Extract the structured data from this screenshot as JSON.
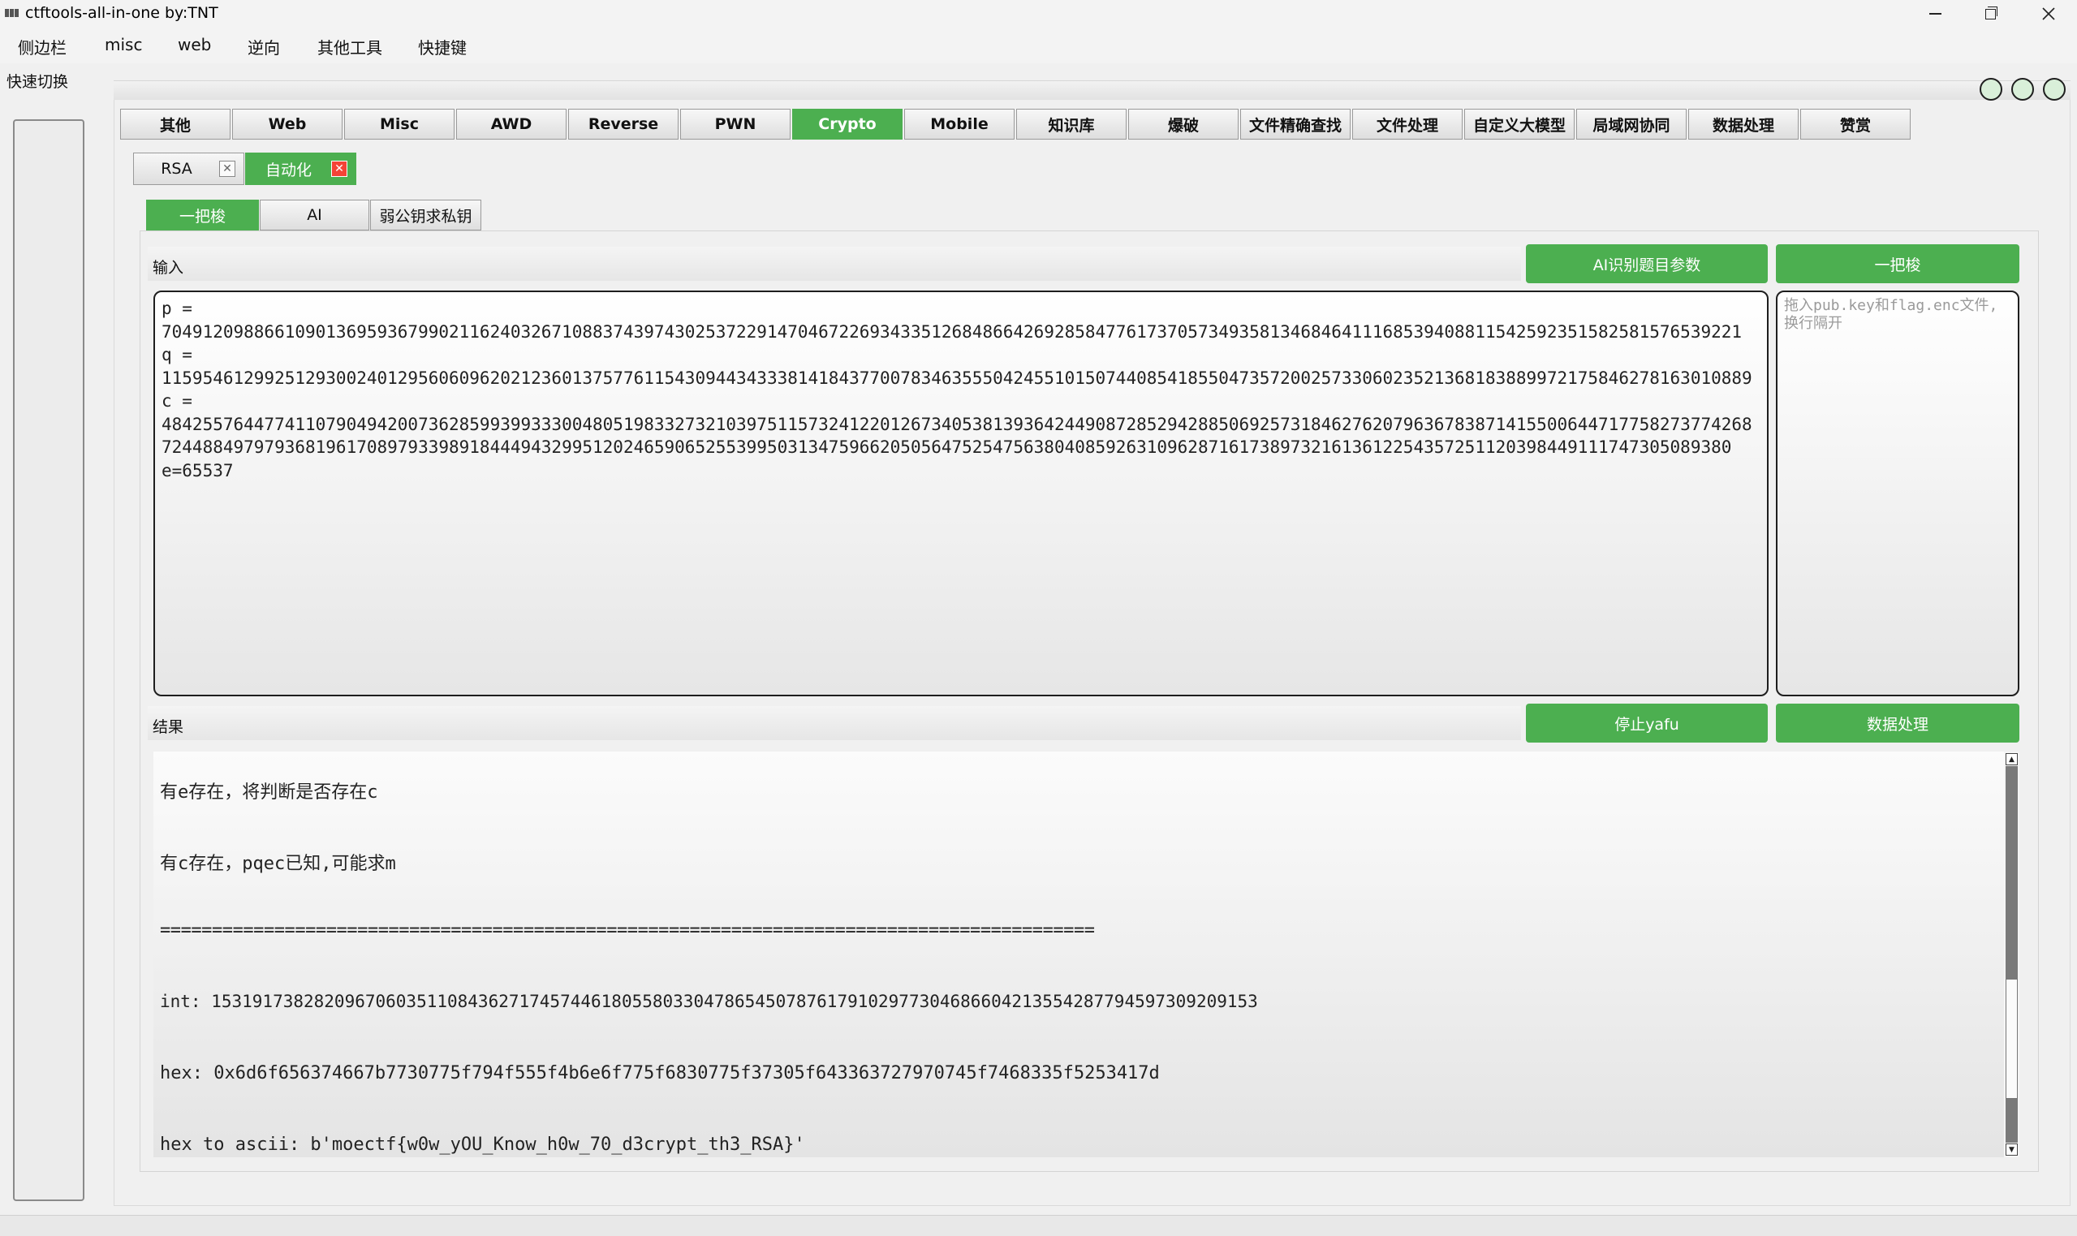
{
  "window": {
    "title": "ctftools-all-in-one   by:TNT"
  },
  "menu": [
    "侧边栏",
    "misc",
    "web",
    "逆向",
    "其他工具",
    "快捷键"
  ],
  "quick_switch_label": "快速切换",
  "tabs": [
    "其他",
    "Web",
    "Misc",
    "AWD",
    "Reverse",
    "PWN",
    "Crypto",
    "Mobile",
    "知识库",
    "爆破",
    "文件精确查找",
    "文件处理",
    "自定义大模型",
    "局域网协同",
    "数据处理",
    "赞赏"
  ],
  "active_tab": "Crypto",
  "sub_tabs": [
    "RSA",
    "自动化"
  ],
  "active_sub_tab": "自动化",
  "mode_tabs": [
    "一把梭",
    "AI",
    "弱公钥求私钥"
  ],
  "active_mode_tab": "一把梭",
  "input_section": {
    "label": "输入",
    "ai_button": "AI识别题目参数",
    "run_button": "一把梭",
    "value": "p =\n7049120988661090136959367990211624032671088374397430253722914704672269343351268486642692858477617370573493581346846411168539408811542592351582581576539221\nq =\n11595461299251293002401295606096202123601375776115430944343338141843770078346355504245510150744085418550473572002573306023521368183889972175846278163010889\nc =\n48425576447741107904942007362859939933300480519833273210397511573241220126734053813936424490872852942885069257318462762079636783871415500644717758273774268724488497979368196170897933989184449432995120246590652553995031347596620505647525475638040859263109628716173897321613612254357251120398449111747305089380\ne=65537",
    "drop_placeholder": "拖入pub.key和flag.enc文件,换行隔开"
  },
  "result_section": {
    "label": "结果",
    "stop_button": "停止yafu",
    "data_button": "数据处理",
    "lines": [
      "有e存在，将判断是否存在c",
      "有c存在，pqec已知,可能求m",
      "==========================================================================================",
      "int: 153191738282096706035110843627174574461805580330478654507876179102977304686604213554287794597309209153",
      "hex: 0x6d6f656374667b7730775f794f555f4b6e6f775f6830775f37305f643363727970745f7468335f5253417d",
      "hex to ascii: b'moectf{w0w_yOU_Know_h0w_70_d3crypt_th3_RSA}'"
    ]
  },
  "colors": {
    "accent": "#4caf50",
    "close_red": "#f44336"
  },
  "icons": {
    "window_controls": [
      "minimize-icon",
      "maximize-icon",
      "close-icon"
    ],
    "status": [
      "circle-icon",
      "circle-icon",
      "circle-icon"
    ]
  }
}
